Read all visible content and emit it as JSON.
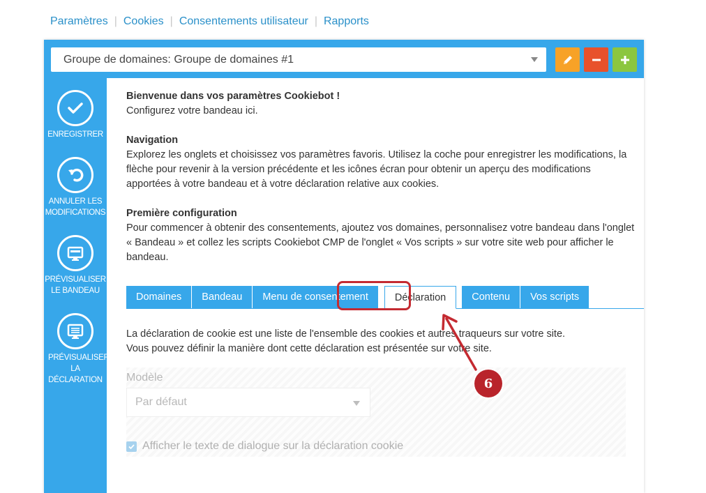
{
  "topnav": {
    "items": [
      {
        "label": "Paramètres"
      },
      {
        "label": "Cookies"
      },
      {
        "label": "Consentements utilisateur"
      },
      {
        "label": "Rapports"
      }
    ]
  },
  "header": {
    "domain_group": "Groupe de domaines: Groupe de domaines #1",
    "buttons": {
      "edit": "pencil-icon",
      "remove": "minus-icon",
      "add": "plus-icon"
    }
  },
  "sidebar": {
    "items": [
      {
        "label": "ENREGISTRER",
        "icon": "checkmark-icon"
      },
      {
        "label": "ANNULER LES MODIFICATIONS",
        "icon": "undo-icon"
      },
      {
        "label": "PRÉVISUALISER LE BANDEAU",
        "icon": "monitor-icon"
      },
      {
        "label": "PRÉVISUALISER LA DÉCLARATION",
        "icon": "monitor-document-icon"
      }
    ]
  },
  "intro": {
    "welcome_title": "Bienvenue dans vos paramètres Cookiebot !",
    "welcome_text": "Configurez votre bandeau ici.",
    "nav_title": "Navigation",
    "nav_text": "Explorez les onglets et choisissez vos paramètres favoris. Utilisez la coche pour enregistrer les modifications, la flèche pour revenir à la version précédente et les icônes écran pour obtenir un aperçu des modifications apportées à votre bandeau et à votre déclaration relative aux cookies.",
    "first_title": "Première configuration",
    "first_text": "Pour commencer à obtenir des consentements, ajoutez vos domaines, personnalisez votre bandeau dans l'onglet « Bandeau » et collez les scripts Cookiebot CMP de l'onglet « Vos scripts » sur votre site web pour afficher le bandeau."
  },
  "tabs": [
    {
      "label": "Domaines"
    },
    {
      "label": "Bandeau"
    },
    {
      "label": "Menu de consentement"
    },
    {
      "label": "Déclaration",
      "active": true
    },
    {
      "label": "Contenu"
    },
    {
      "label": "Vos scripts"
    }
  ],
  "declaration": {
    "description_line1": "La déclaration de cookie est une liste de l'ensemble des cookies et autres traqueurs sur votre site.",
    "description_line2": "Vous pouvez définir la manière dont cette déclaration est présentée sur votre site.",
    "template_label": "Modèle",
    "template_value": "Par défaut",
    "checkbox_label": "Afficher le texte de dialogue sur la déclaration cookie",
    "checkbox_checked": true
  },
  "annotation": {
    "step": "6"
  },
  "colors": {
    "accent": "#37a7ea",
    "edit": "#f7a227",
    "remove": "#e8512b",
    "add": "#8cc63f",
    "highlight": "#c42a31"
  }
}
